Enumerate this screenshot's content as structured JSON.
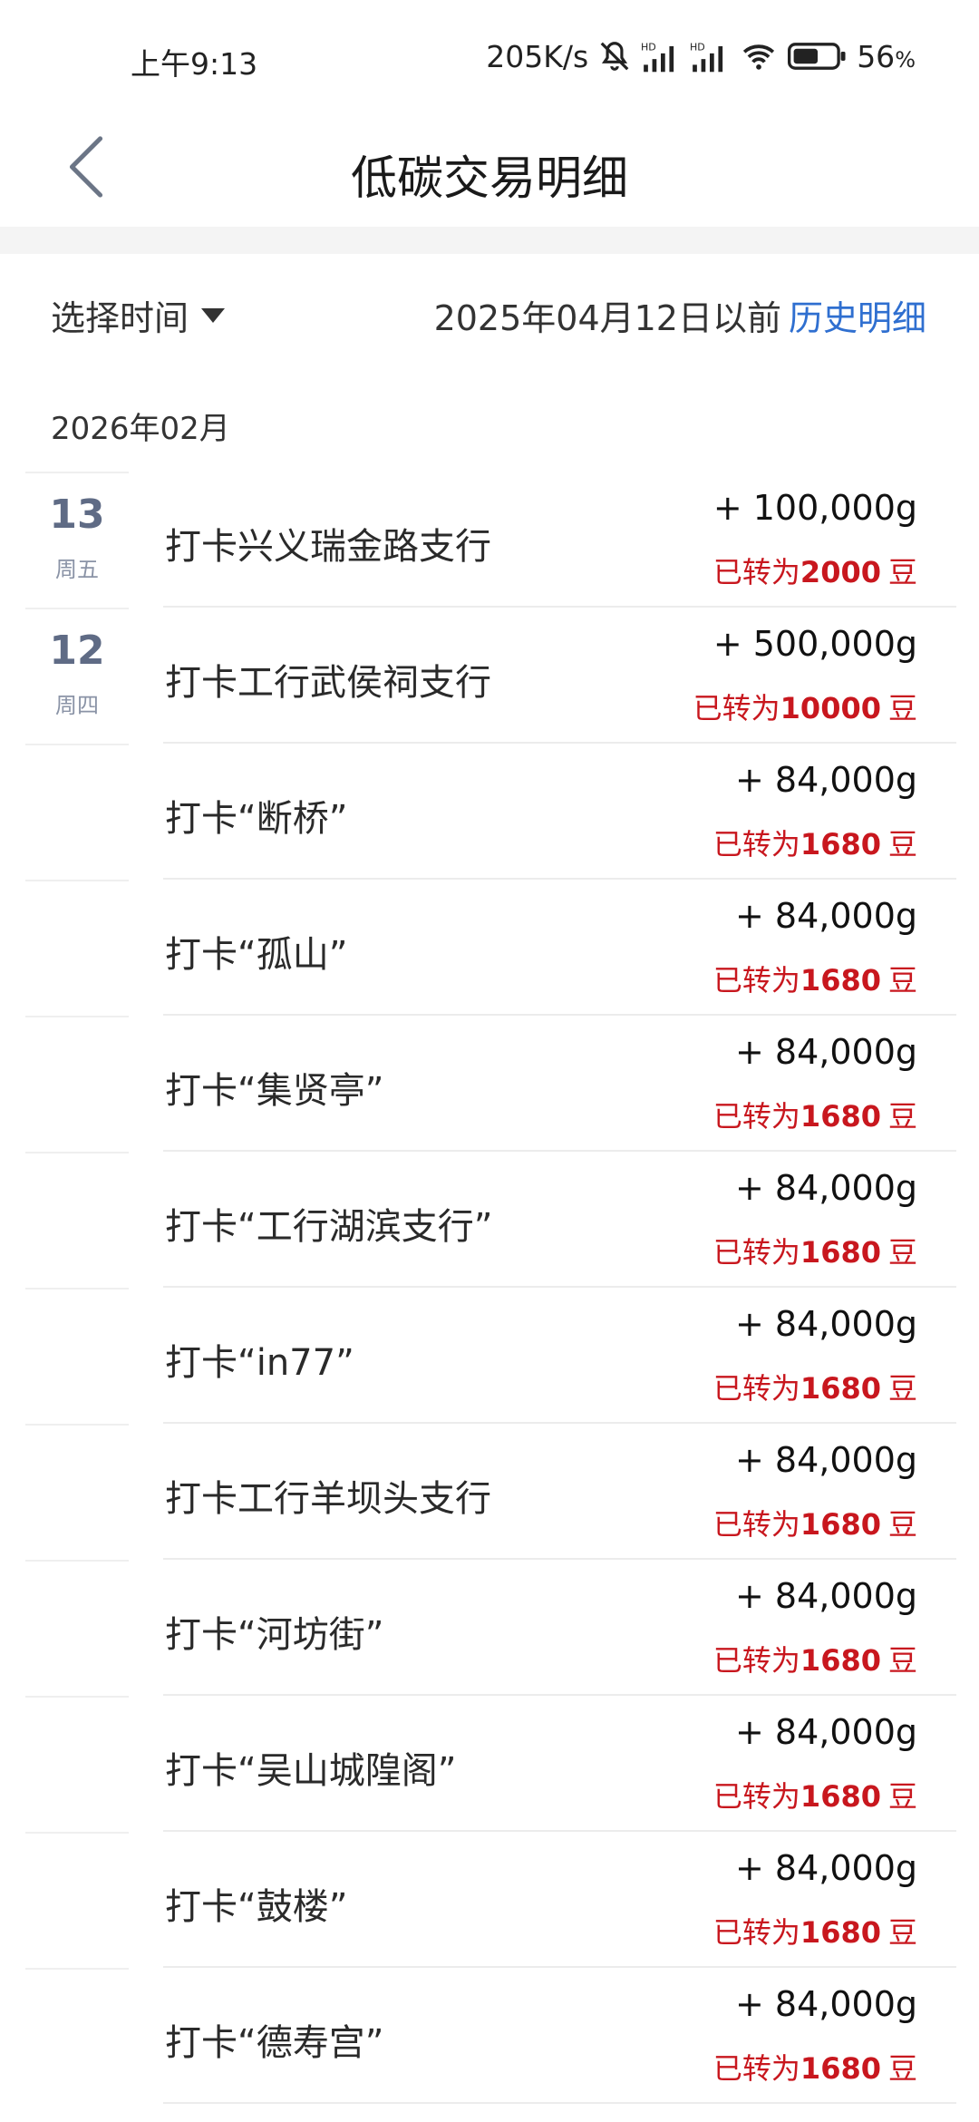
{
  "status_bar": {
    "time": "上午9:13",
    "speed": "205K/s",
    "battery": "56",
    "battery_unit": "%"
  },
  "header": {
    "title": "低碳交易明细"
  },
  "filter": {
    "select_label": "选择时间",
    "before_text": "2025年04月12日以前",
    "history_link": "历史明细"
  },
  "month": "2026年02月",
  "items": [
    {
      "day": "13",
      "weekday": "周五",
      "title": "打卡兴义瑞金路支行",
      "amount": "+ 100,000g",
      "conv_prefix": "已转为",
      "conv_value": "2000",
      "conv_unit": "豆"
    },
    {
      "day": "12",
      "weekday": "周四",
      "title": "打卡工行武侯祠支行",
      "amount": "+ 500,000g",
      "conv_prefix": "已转为",
      "conv_value": "10000",
      "conv_unit": "豆"
    },
    {
      "day": "",
      "weekday": "",
      "title": "打卡“断桥”",
      "amount": "+ 84,000g",
      "conv_prefix": "已转为",
      "conv_value": "1680",
      "conv_unit": "豆"
    },
    {
      "day": "",
      "weekday": "",
      "title": "打卡“孤山”",
      "amount": "+ 84,000g",
      "conv_prefix": "已转为",
      "conv_value": "1680",
      "conv_unit": "豆"
    },
    {
      "day": "",
      "weekday": "",
      "title": "打卡“集贤亭”",
      "amount": "+ 84,000g",
      "conv_prefix": "已转为",
      "conv_value": "1680",
      "conv_unit": "豆"
    },
    {
      "day": "",
      "weekday": "",
      "title": "打卡“工行湖滨支行”",
      "amount": "+ 84,000g",
      "conv_prefix": "已转为",
      "conv_value": "1680",
      "conv_unit": "豆"
    },
    {
      "day": "",
      "weekday": "",
      "title": "打卡“in77”",
      "amount": "+ 84,000g",
      "conv_prefix": "已转为",
      "conv_value": "1680",
      "conv_unit": "豆"
    },
    {
      "day": "",
      "weekday": "",
      "title": "打卡工行羊坝头支行",
      "amount": "+ 84,000g",
      "conv_prefix": "已转为",
      "conv_value": "1680",
      "conv_unit": "豆"
    },
    {
      "day": "",
      "weekday": "",
      "title": "打卡“河坊街”",
      "amount": "+ 84,000g",
      "conv_prefix": "已转为",
      "conv_value": "1680",
      "conv_unit": "豆"
    },
    {
      "day": "",
      "weekday": "",
      "title": "打卡“吴山城隍阁”",
      "amount": "+ 84,000g",
      "conv_prefix": "已转为",
      "conv_value": "1680",
      "conv_unit": "豆"
    },
    {
      "day": "",
      "weekday": "",
      "title": "打卡“鼓楼”",
      "amount": "+ 84,000g",
      "conv_prefix": "已转为",
      "conv_value": "1680",
      "conv_unit": "豆"
    },
    {
      "day": "",
      "weekday": "",
      "title": "打卡“德寿宫”",
      "amount": "+ 84,000g",
      "conv_prefix": "已转为",
      "conv_value": "1680",
      "conv_unit": "豆"
    }
  ],
  "colors": {
    "accent_link": "#2f6fd0",
    "conversion_red": "#c8171e",
    "date_blue_gray": "#5f6b85"
  },
  "icons": {
    "back": "chevron-left-icon",
    "dropdown": "caret-down-icon"
  }
}
